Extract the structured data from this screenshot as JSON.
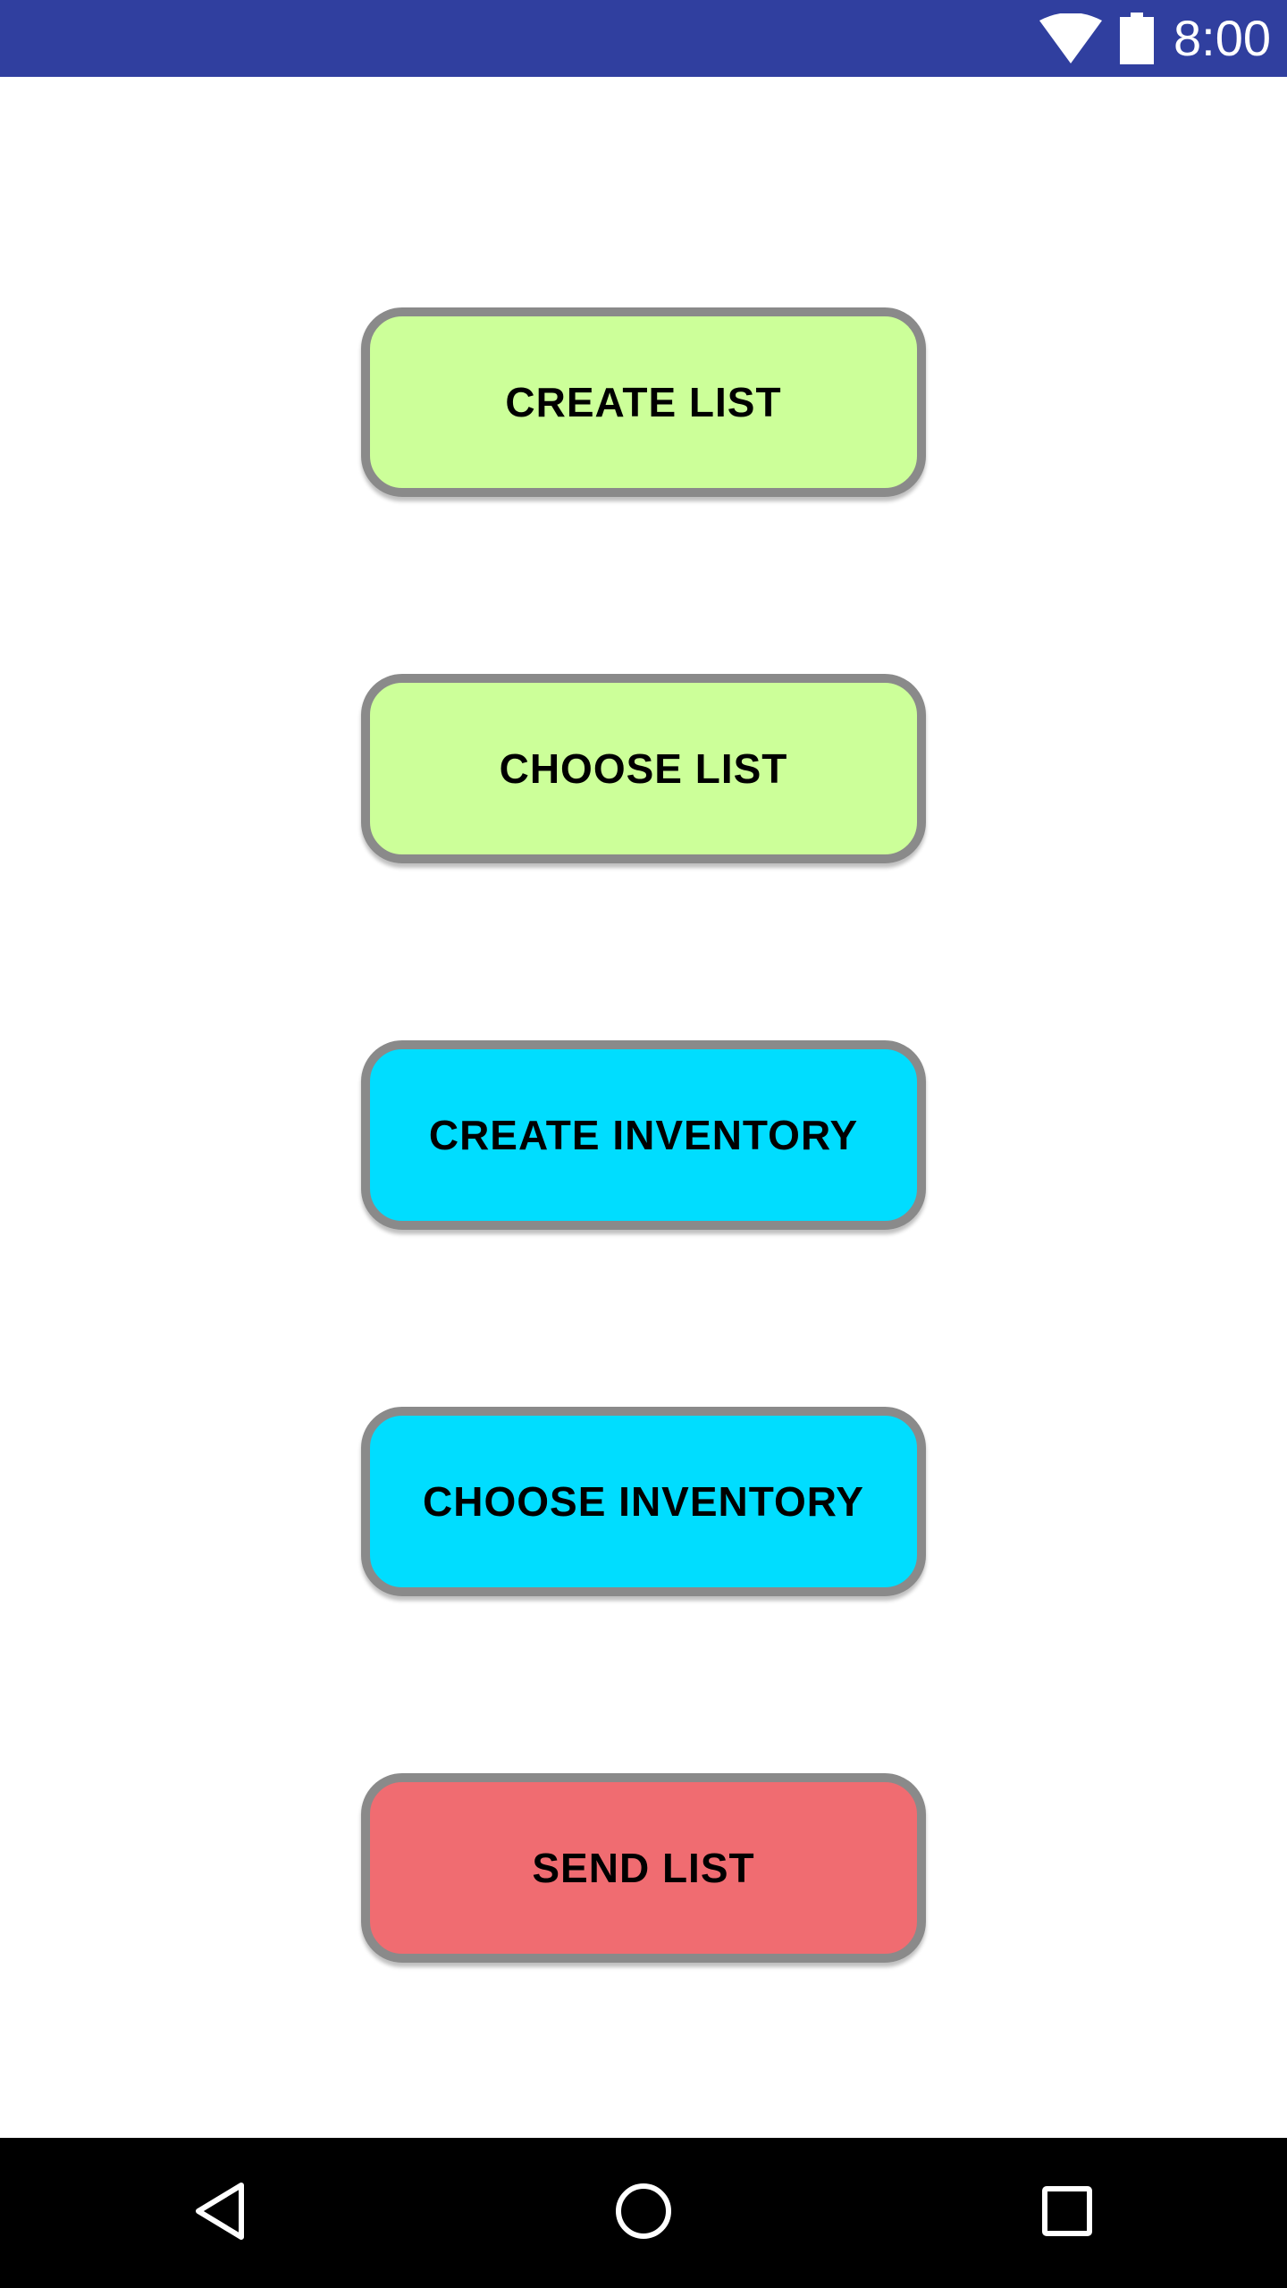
{
  "status_bar": {
    "time": "8:00",
    "background": "#303F9F",
    "icons": [
      "wifi-icon",
      "battery-icon"
    ]
  },
  "buttons": [
    {
      "label": "CREATE LIST",
      "color": "#CCFF99"
    },
    {
      "label": "CHOOSE LIST",
      "color": "#CCFF99"
    },
    {
      "label": "CREATE INVENTORY",
      "color": "#00DDFF"
    },
    {
      "label": "CHOOSE INVENTORY",
      "color": "#00DDFF"
    },
    {
      "label": "SEND LIST",
      "color": "#F06C71"
    }
  ],
  "button_border_color": "#8A8A8A",
  "nav_bar": {
    "icons": [
      "back-icon",
      "home-icon",
      "recents-icon"
    ]
  }
}
